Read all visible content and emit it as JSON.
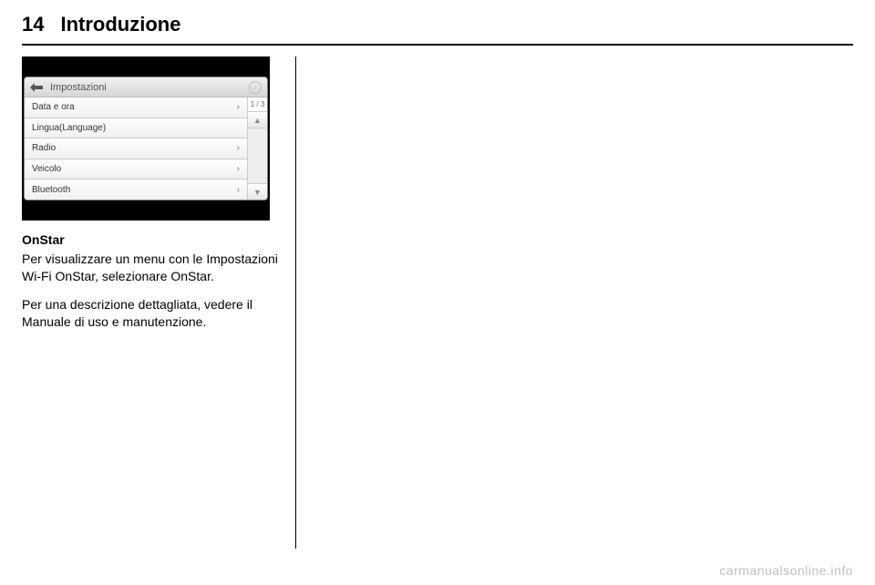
{
  "header": {
    "page_number": "14",
    "chapter": "Introduzione"
  },
  "screenshot": {
    "title": "Impostazioni",
    "page_indicator": "1 / 3",
    "menu": [
      {
        "label": "Data e ora",
        "has_chevron": true
      },
      {
        "label": "Lingua(Language)",
        "has_chevron": false
      },
      {
        "label": "Radio",
        "has_chevron": true
      },
      {
        "label": "Veicolo",
        "has_chevron": true
      },
      {
        "label": "Bluetooth",
        "has_chevron": true
      }
    ]
  },
  "body": {
    "subhead": "OnStar",
    "para1": "Per visualizzare un menu con le Impostazioni Wi-Fi OnStar, selezionare OnStar.",
    "para2": "Per una descrizione dettagliata, vedere il Manuale di uso e manutenzione."
  },
  "watermark": "carmanualsonline.info"
}
